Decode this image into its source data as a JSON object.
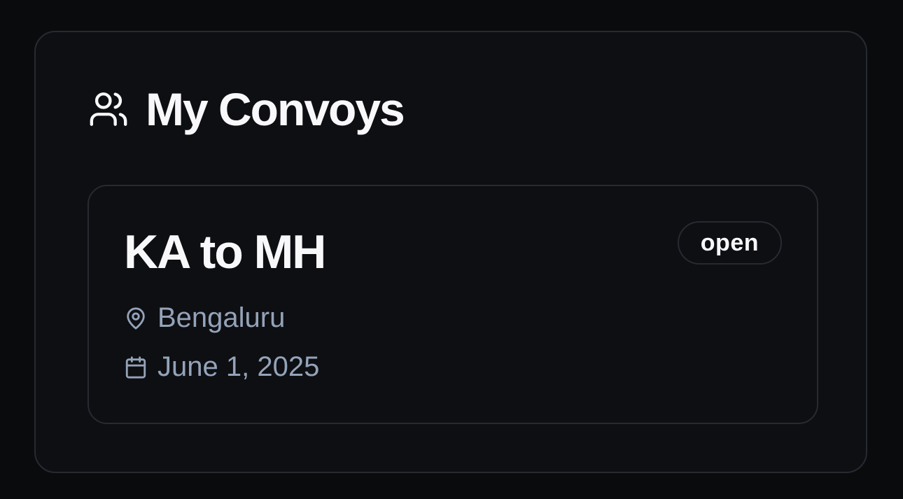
{
  "panel": {
    "title": "My Convoys",
    "icon": "users-icon"
  },
  "convoys": [
    {
      "title": "KA to MH",
      "status": "open",
      "location": "Bengaluru",
      "location_icon": "map-pin-icon",
      "date": "June 1, 2025",
      "date_icon": "calendar-icon"
    }
  ],
  "colors": {
    "background": "#0a0b0d",
    "panel": "#0e0f13",
    "border": "#272a31",
    "text_primary": "#f8f8fa",
    "text_muted": "#94a3b8"
  }
}
